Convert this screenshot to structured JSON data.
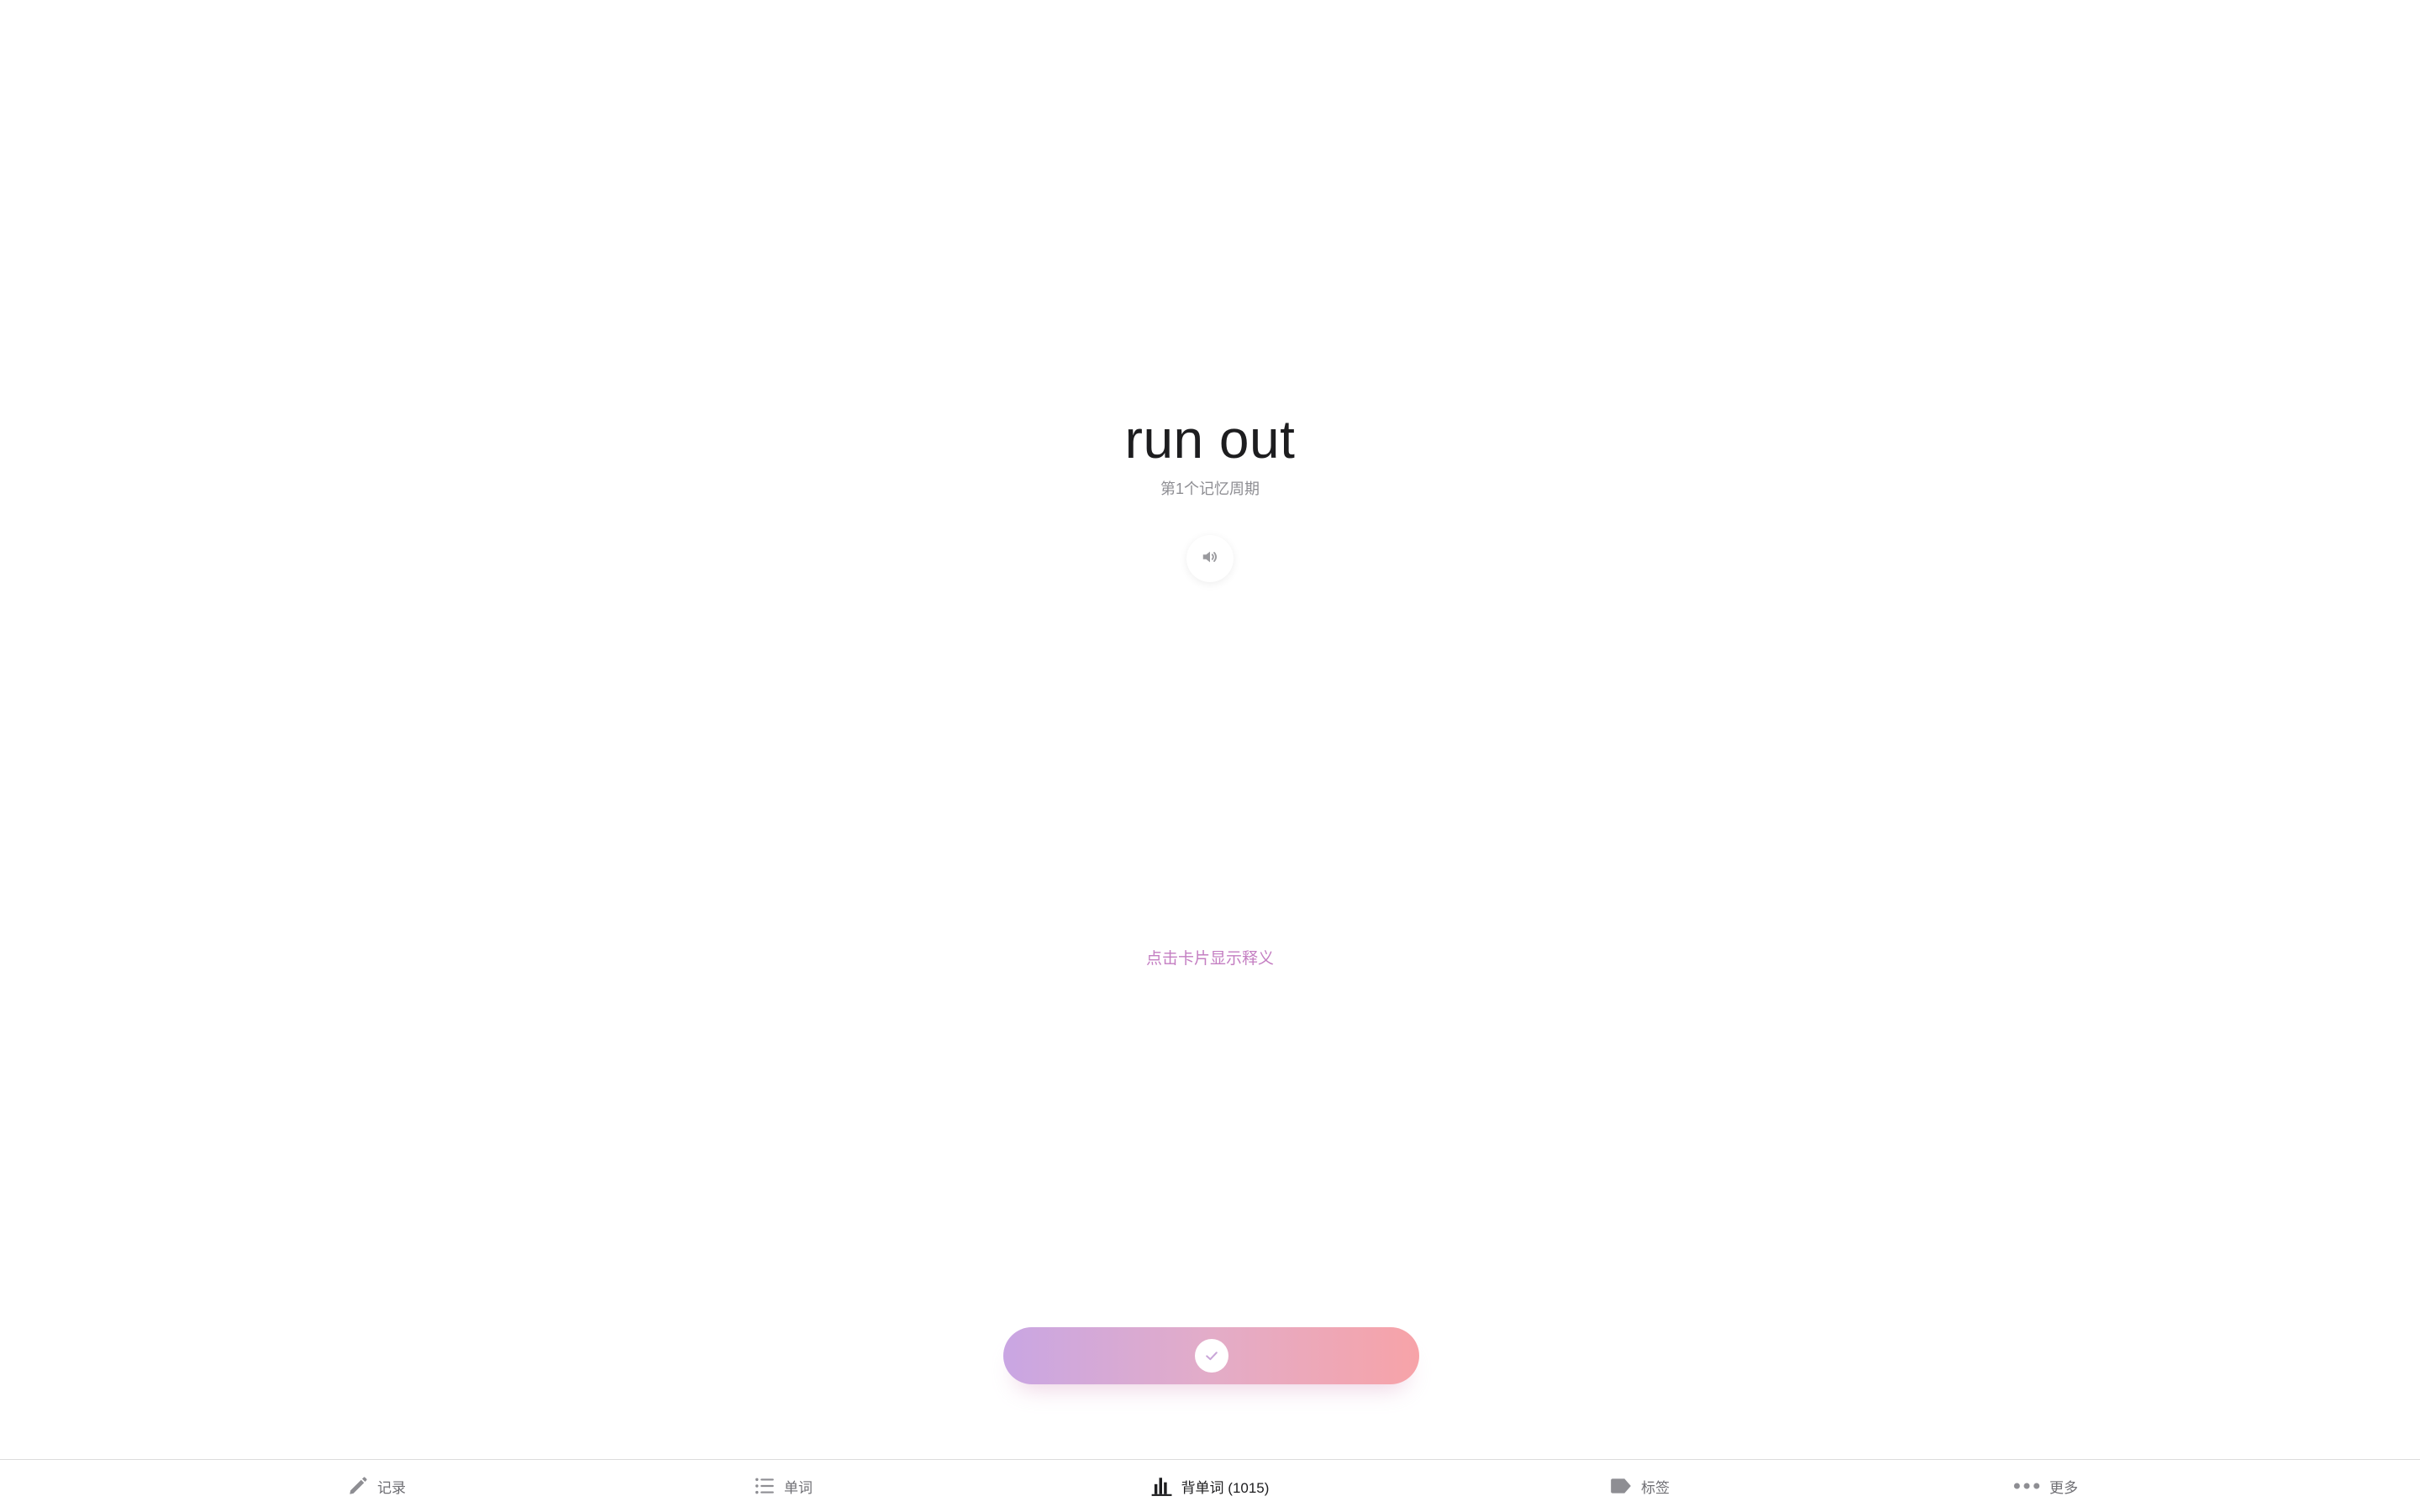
{
  "card": {
    "word": "run out",
    "cycle": "第1个记忆周期",
    "hint": "点击卡片显示释义"
  },
  "icons": {
    "speaker": "speaker-icon",
    "confirm": "check-icon"
  },
  "colors": {
    "gradient_start": "#c9a6e3",
    "gradient_end": "#f7a3a8",
    "hint": "#c47ec2",
    "active_tab": "#1d1d1f",
    "inactive_tab": "#8e8e93"
  },
  "tabbar": {
    "items": [
      {
        "label": "记录",
        "icon": "pencil-icon"
      },
      {
        "label": "单词",
        "icon": "list-icon"
      },
      {
        "label": "背单词 (1015)",
        "icon": "bar-chart-icon",
        "active": true
      },
      {
        "label": "标签",
        "icon": "tag-icon"
      },
      {
        "label": "更多",
        "icon": "more-icon"
      }
    ]
  }
}
